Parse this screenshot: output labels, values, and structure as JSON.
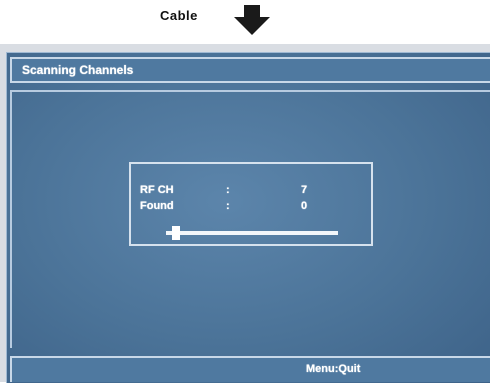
{
  "caption": {
    "text": "Cable",
    "arrow_icon": "down-arrow-icon"
  },
  "dialog": {
    "title": "Scanning Channels",
    "rows": [
      {
        "label": "RF CH",
        "separator": ":",
        "value": "7"
      },
      {
        "label": "Found",
        "separator": ":",
        "value": "0"
      }
    ],
    "progress": {
      "fraction": 0.06
    }
  },
  "footer": {
    "hint": "Menu:Quit"
  },
  "colors": {
    "screen_blue": "#4b7398",
    "bar_blue": "#4f79a0",
    "text": "#ffffff"
  }
}
